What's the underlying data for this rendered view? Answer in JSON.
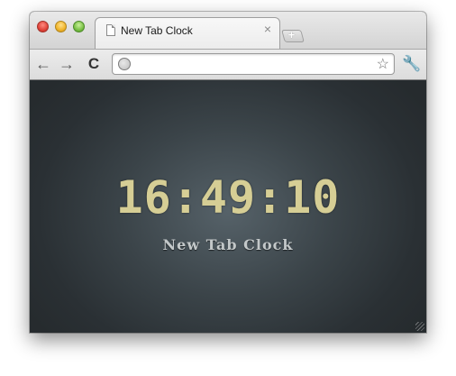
{
  "window": {
    "tab": {
      "title": "New Tab Clock",
      "close_glyph": "×"
    },
    "new_tab_glyph": "+"
  },
  "toolbar": {
    "back_glyph": "←",
    "forward_glyph": "→",
    "reload_glyph": "C",
    "address_value": "",
    "star_glyph": "☆",
    "wrench_glyph": "🔧"
  },
  "page": {
    "clock_time": "16:49:10",
    "clock_label": "New Tab Clock"
  }
}
